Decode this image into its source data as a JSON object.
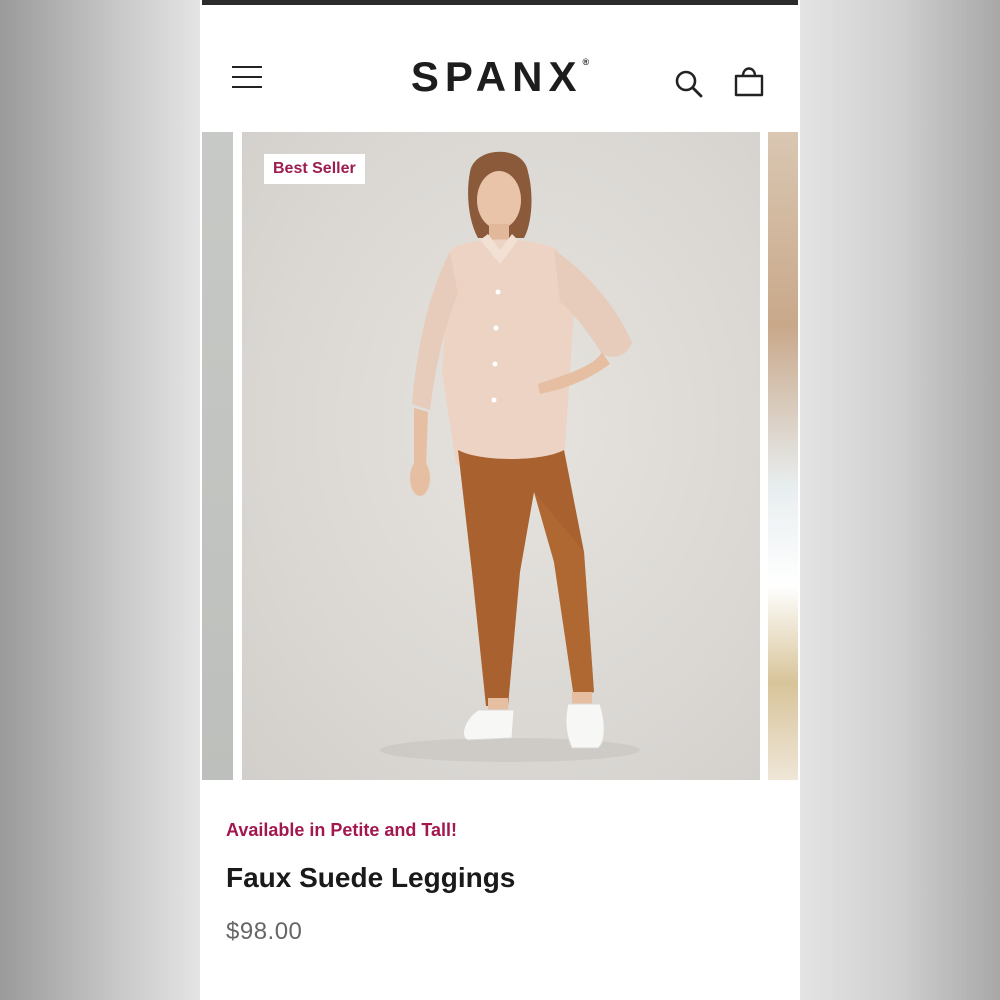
{
  "brand": {
    "name": "SPANX",
    "mark": "®"
  },
  "header": {
    "menu_icon": "hamburger-menu-icon",
    "search_icon": "search-icon",
    "bag_icon": "shopping-bag-icon"
  },
  "product": {
    "badge": "Best Seller",
    "tagline": "Available in Petite and Tall!",
    "name": "Faux Suede Leggings",
    "price": "$98.00"
  },
  "colors": {
    "accent": "#a3174f",
    "text": "#1a1a1a",
    "price": "#666666",
    "legging": "#a8612f",
    "shirt": "#ecd3c4"
  }
}
